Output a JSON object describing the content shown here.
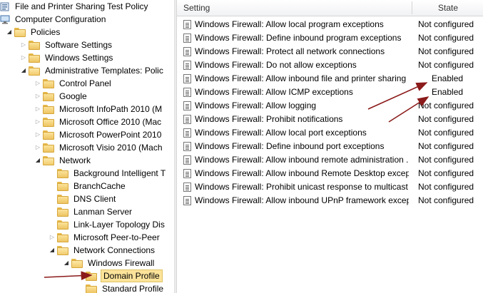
{
  "tree": {
    "nodes": [
      {
        "label": "File and Printer Sharing Test Policy",
        "depth": 0,
        "toggle": "",
        "icon": "policy"
      },
      {
        "label": "Computer Configuration",
        "depth": 0,
        "toggle": "open",
        "icon": "computer"
      },
      {
        "label": "Policies",
        "depth": 1,
        "toggle": "open",
        "icon": "folder"
      },
      {
        "label": "Software Settings",
        "depth": 2,
        "toggle": "closed",
        "icon": "folder"
      },
      {
        "label": "Windows Settings",
        "depth": 2,
        "toggle": "closed",
        "icon": "folder"
      },
      {
        "label": "Administrative Templates: Polic",
        "depth": 2,
        "toggle": "open",
        "icon": "folder"
      },
      {
        "label": "Control Panel",
        "depth": 3,
        "toggle": "closed",
        "icon": "folder"
      },
      {
        "label": "Google",
        "depth": 3,
        "toggle": "closed",
        "icon": "folder"
      },
      {
        "label": "Microsoft InfoPath 2010 (M",
        "depth": 3,
        "toggle": "closed",
        "icon": "folder"
      },
      {
        "label": "Microsoft Office 2010 (Mac",
        "depth": 3,
        "toggle": "closed",
        "icon": "folder"
      },
      {
        "label": "Microsoft PowerPoint 2010",
        "depth": 3,
        "toggle": "closed",
        "icon": "folder"
      },
      {
        "label": "Microsoft Visio 2010 (Mach",
        "depth": 3,
        "toggle": "closed",
        "icon": "folder"
      },
      {
        "label": "Network",
        "depth": 3,
        "toggle": "open",
        "icon": "folder"
      },
      {
        "label": "Background Intelligent T",
        "depth": 4,
        "toggle": "",
        "icon": "folder"
      },
      {
        "label": "BranchCache",
        "depth": 4,
        "toggle": "",
        "icon": "folder"
      },
      {
        "label": "DNS Client",
        "depth": 4,
        "toggle": "",
        "icon": "folder"
      },
      {
        "label": "Lanman Server",
        "depth": 4,
        "toggle": "",
        "icon": "folder"
      },
      {
        "label": "Link-Layer Topology Dis",
        "depth": 4,
        "toggle": "",
        "icon": "folder"
      },
      {
        "label": "Microsoft Peer-to-Peer",
        "depth": 4,
        "toggle": "closed",
        "icon": "folder"
      },
      {
        "label": "Network Connections",
        "depth": 4,
        "toggle": "open",
        "icon": "folder"
      },
      {
        "label": "Windows Firewall",
        "depth": 5,
        "toggle": "open",
        "icon": "folder"
      },
      {
        "label": "Domain Profile",
        "depth": 6,
        "toggle": "",
        "icon": "folder",
        "selected": true
      },
      {
        "label": "Standard Profile",
        "depth": 6,
        "toggle": "",
        "icon": "folder"
      }
    ]
  },
  "list": {
    "columns": {
      "setting": "Setting",
      "state": "State"
    },
    "rows": [
      {
        "setting": "Windows Firewall: Allow local program exceptions",
        "state": "Not configured"
      },
      {
        "setting": "Windows Firewall: Define inbound program exceptions",
        "state": "Not configured"
      },
      {
        "setting": "Windows Firewall: Protect all network connections",
        "state": "Not configured"
      },
      {
        "setting": "Windows Firewall: Do not allow exceptions",
        "state": "Not configured"
      },
      {
        "setting": "Windows Firewall: Allow inbound file and printer sharing ...",
        "state": "Enabled"
      },
      {
        "setting": "Windows Firewall: Allow ICMP exceptions",
        "state": "Enabled"
      },
      {
        "setting": "Windows Firewall: Allow logging",
        "state": "Not configured"
      },
      {
        "setting": "Windows Firewall: Prohibit notifications",
        "state": "Not configured"
      },
      {
        "setting": "Windows Firewall: Allow local port exceptions",
        "state": "Not configured"
      },
      {
        "setting": "Windows Firewall: Define inbound port exceptions",
        "state": "Not configured"
      },
      {
        "setting": "Windows Firewall: Allow inbound remote administration ...",
        "state": "Not configured"
      },
      {
        "setting": "Windows Firewall: Allow inbound Remote Desktop excep...",
        "state": "Not configured"
      },
      {
        "setting": "Windows Firewall: Prohibit unicast response to multicast ...",
        "state": "Not configured"
      },
      {
        "setting": "Windows Firewall: Allow inbound UPnP framework excep...",
        "state": "Not configured"
      }
    ]
  },
  "annotations": {
    "arrow_color": "#8b1a1a"
  }
}
